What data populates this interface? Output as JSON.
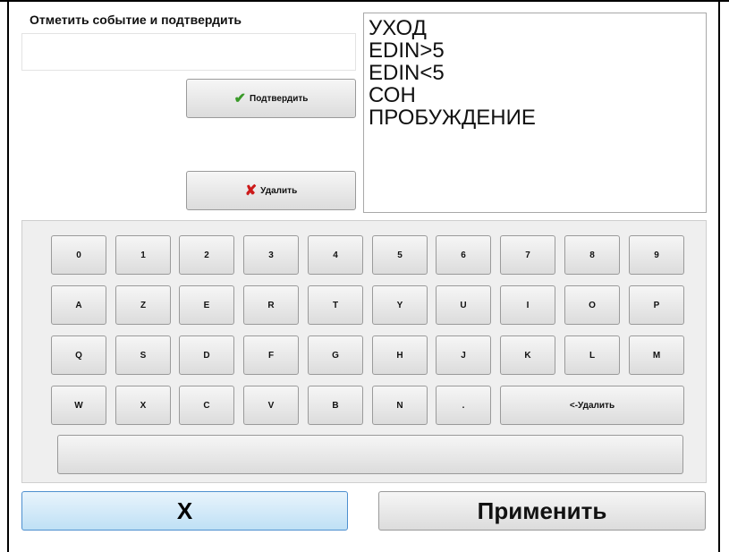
{
  "form": {
    "title": "Отметить событие и подтвердить",
    "input_value": "",
    "confirm_label": "Подтвердить",
    "delete_label": "Удалить"
  },
  "events": [
    "УХОД",
    "EDIN>5",
    "EDIN<5",
    "СОН",
    "ПРОБУЖДЕНИЕ"
  ],
  "keyboard": {
    "rows": [
      [
        "0",
        "1",
        "2",
        "3",
        "4",
        "5",
        "6",
        "7",
        "8",
        "9"
      ],
      [
        "A",
        "Z",
        "E",
        "R",
        "T",
        "Y",
        "U",
        "I",
        "O",
        "P"
      ],
      [
        "Q",
        "S",
        "D",
        "F",
        "G",
        "H",
        "J",
        "K",
        "L",
        "M"
      ],
      [
        "W",
        "X",
        "C",
        "V",
        "B",
        "N",
        "."
      ]
    ],
    "backspace_label": "<-Удалить",
    "space_label": ""
  },
  "footer": {
    "cancel_label": "X",
    "apply_label": "Применить"
  },
  "colors": {
    "confirm_icon": "#3a9a2a",
    "delete_icon": "#cc1a1a",
    "cancel_button_border": "#4d8fcf"
  },
  "icons": {
    "confirm": "checkmark-icon",
    "delete": "cross-icon"
  }
}
